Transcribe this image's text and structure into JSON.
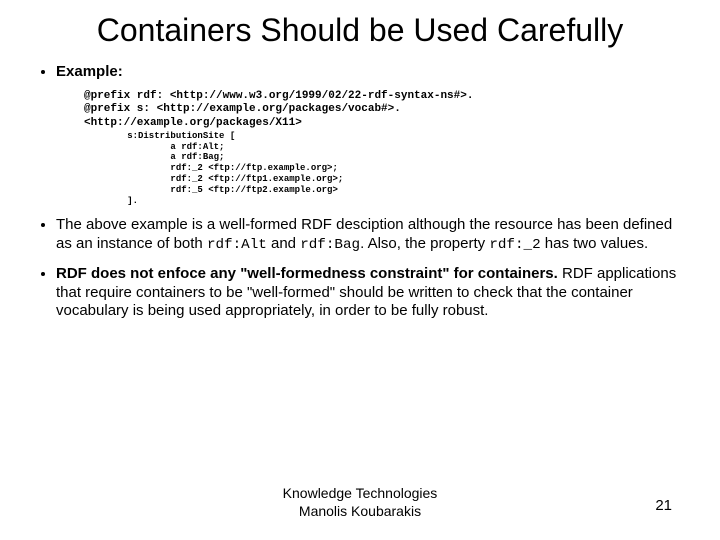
{
  "title": "Containers Should be Used Carefully",
  "bullets": {
    "example_label": "Example:",
    "code_line1": "@prefix rdf: <http://www.w3.org/1999/02/22-rdf-syntax-ns#>.",
    "code_line2": "@prefix s: <http://example.org/packages/vocab#>.",
    "code_line3": "<http://example.org/packages/X11>",
    "code_small": "        s:DistributionSite [\n                a rdf:Alt;\n                a rdf:Bag;\n                rdf:_2 <ftp://ftp.example.org>;\n                rdf:_2 <ftp://ftp1.example.org>;\n                rdf:_5 <ftp://ftp2.example.org>\n        ].",
    "para1_a": "The above example is a well-formed RDF desciption although the resource has been defined as an instance of both ",
    "para1_code1": "rdf:Alt",
    "para1_b": " and ",
    "para1_code2": "rdf:Bag",
    "para1_c": ". Also, the property ",
    "para1_code3": "rdf:_2",
    "para1_d": " has two values.",
    "para2_bold": "RDF does not enfoce any \"well-formedness constraint\" for containers.",
    "para2_rest": " RDF applications that require containers to be \"well-formed\" should be written to check that the container vocabulary is being used appropriately, in order to be fully robust."
  },
  "footer_line1": "Knowledge Technologies",
  "footer_line2": "Manolis Koubarakis",
  "page_number": "21"
}
